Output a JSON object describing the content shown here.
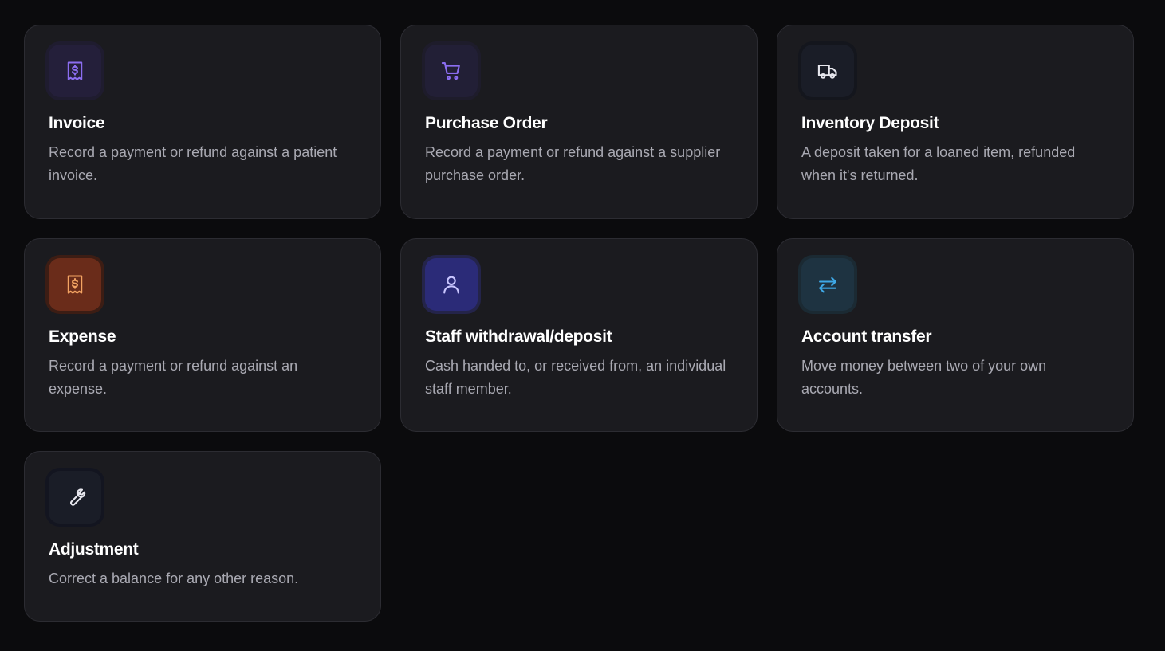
{
  "cards": [
    {
      "title": "Invoice",
      "description": "Record a payment or refund against a patient invoice.",
      "icon": "receipt-dollar-icon",
      "accent": "#8b6df0"
    },
    {
      "title": "Purchase Order",
      "description": "Record a payment or refund against a supplier purchase order.",
      "icon": "shopping-cart-icon",
      "accent": "#8b6df0"
    },
    {
      "title": "Inventory Deposit",
      "description": "A deposit taken for a loaned item, refunded when it's returned.",
      "icon": "truck-icon",
      "accent": "#e7e7ee"
    },
    {
      "title": "Expense",
      "description": "Record a payment or refund against an expense.",
      "icon": "receipt-dollar-icon",
      "accent": "#f4a463"
    },
    {
      "title": "Staff withdrawal/deposit",
      "description": "Cash handed to, or received from, an individual staff member.",
      "icon": "user-icon",
      "accent": "#c9c6ff"
    },
    {
      "title": "Account transfer",
      "description": "Move money between two of your own accounts.",
      "icon": "arrows-left-right-icon",
      "accent": "#3ea8e6"
    },
    {
      "title": "Adjustment",
      "description": "Correct a balance for any other reason.",
      "icon": "wrench-icon",
      "accent": "#e7e7ee"
    }
  ]
}
